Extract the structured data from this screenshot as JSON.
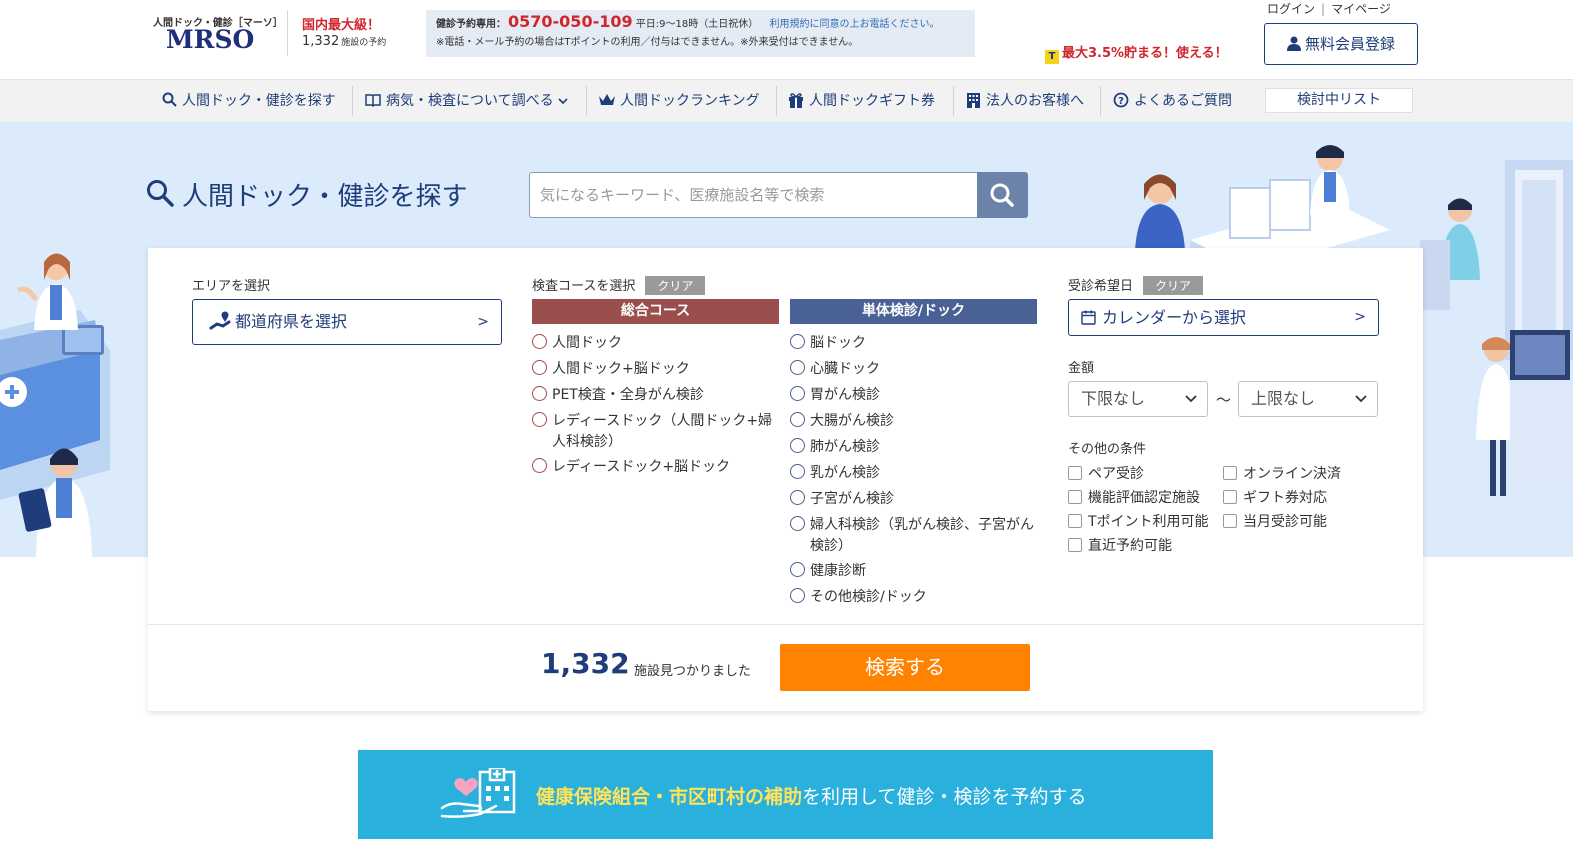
{
  "header": {
    "logo_sub": "人間ドック・健診［マーソ］",
    "logo": "MRSO",
    "claim_title": "国内最大級！",
    "claim_count": "1,332",
    "claim_suffix": "施設の予約",
    "phone_label": "健診予約専用：",
    "phone_number": "0570-050-109",
    "phone_hours": "平日:9～18時（土日祝休）",
    "phone_consent": "利用規約に同意の上お電話ください。",
    "phone_note": "※電話・メール予約の場合はTポイントの利用／付与はできません。※外来受付はできません。",
    "login": "ログイン",
    "sep": "|",
    "mypage": "マイページ",
    "tpoint_text": "最大3.5%貯まる！使える！",
    "register_label": "無料会員登録"
  },
  "nav": {
    "items": [
      {
        "label": "人間ドック・健診を探す",
        "icon": "search-icon"
      },
      {
        "label": "病気・検査について調べる",
        "icon": "book-icon"
      },
      {
        "label": "人間ドックランキング",
        "icon": "crown-icon"
      },
      {
        "label": "人間ドックギフト券",
        "icon": "gift-icon"
      },
      {
        "label": "法人のお客様へ",
        "icon": "building-icon"
      },
      {
        "label": "よくあるご質問",
        "icon": "question-icon"
      }
    ],
    "watchlist": "検討中リスト"
  },
  "hero": {
    "title": "人間ドック・健診を探す",
    "search_placeholder": "気になるキーワード、医療施設名等で検索"
  },
  "panel": {
    "area_label": "エリアを選択",
    "pref_button": "都道府県を選択",
    "pref_arrow": ">",
    "course_label": "検査コースを選択",
    "clear": "クリア",
    "comprehensive_head": "総合コース",
    "single_head": "単体検診/ドック",
    "comprehensive": [
      "人間ドック",
      "人間ドック+脳ドック",
      "PET検査・全身がん検診",
      "レディースドック（人間ドック+婦",
      "人科検診）",
      "レディースドック+脳ドック"
    ],
    "single": [
      "脳ドック",
      "心臓ドック",
      "胃がん検診",
      "大腸がん検診",
      "肺がん検診",
      "乳がん検診",
      "子宮がん検診",
      "婦人科検診（乳がん検診、子宮がん",
      "検診）",
      "健康診断",
      "その他検診/ドック"
    ],
    "date_label": "受診希望日",
    "calendar_button": "カレンダーから選択",
    "calendar_arrow": ">",
    "price_label": "金額",
    "price_min": "下限なし",
    "price_max": "上限なし",
    "tilde": "～",
    "other_label": "その他の条件",
    "other_options": [
      "ペア受診",
      "オンライン決済",
      "機能評価認定施設",
      "ギフト券対応",
      "Tポイント利用可能",
      "当月受診可能",
      "直近予約可能"
    ],
    "result_count": "1,332",
    "result_suffix": "施設見つかりました",
    "submit": "検索する"
  },
  "banner": {
    "highlight": "健康保険組合・市区町村の補助",
    "rest": "を利用して健診・検診を予約する"
  },
  "colors": {
    "navy": "#1f3d7a",
    "red": "#d1262d",
    "orange": "#ff8300",
    "comprehensive": "#9b4e4e",
    "single": "#4a6195",
    "hero_bg": "#dcebfb",
    "banner": "#2ab0dc"
  }
}
